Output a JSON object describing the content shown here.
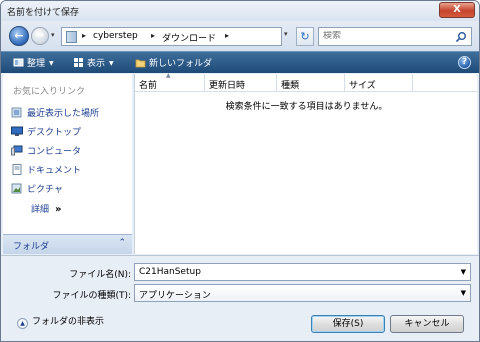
{
  "window": {
    "title": "名前を付けて保存",
    "close_glyph": "X"
  },
  "address": {
    "back_glyph": "←",
    "forward_glyph": "→",
    "recent_glyph": "▾",
    "separator": "▸",
    "breadcrumbs": [
      "cyberstep",
      "ダウンロード"
    ],
    "go_glyph": "▾",
    "refresh_glyph": "↻"
  },
  "search": {
    "placeholder": "検索"
  },
  "toolbar": {
    "organize": "整理",
    "views": "表示",
    "new_folder": "新しいフォルダ",
    "help": "?"
  },
  "sidebar": {
    "heading": "お気に入りリンク",
    "links": [
      {
        "label": "最近表示した場所",
        "icon": "recent-places-icon"
      },
      {
        "label": "デスクトップ",
        "icon": "desktop-icon"
      },
      {
        "label": "コンピュータ",
        "icon": "computer-icon"
      },
      {
        "label": "ドキュメント",
        "icon": "documents-icon"
      },
      {
        "label": "ピクチャ",
        "icon": "pictures-icon"
      }
    ],
    "details": "詳細",
    "details_arrows": "»",
    "folders": "フォルダ",
    "folders_chevron": "⌃"
  },
  "filelist": {
    "columns": [
      "名前",
      "更新日時",
      "種類",
      "サイズ"
    ],
    "sort_glyph": "▲",
    "empty_message": "検索条件に一致する項目はありません。"
  },
  "form": {
    "filename_label": "ファイル名(N):",
    "filename_value": "C21HanSetup",
    "filetype_label": "ファイルの種類(T):",
    "filetype_value": "アプリケーション",
    "dropdown_glyph": "▼",
    "hide_folders": "フォルダの非表示",
    "hide_folders_glyph": "▲",
    "save_button": "保存(S)",
    "cancel_button": "キャンセル"
  },
  "colors": {
    "toolbar": "#2c5b8a",
    "link": "#1b3d8f",
    "dialog_bg": "#e8eef6"
  }
}
